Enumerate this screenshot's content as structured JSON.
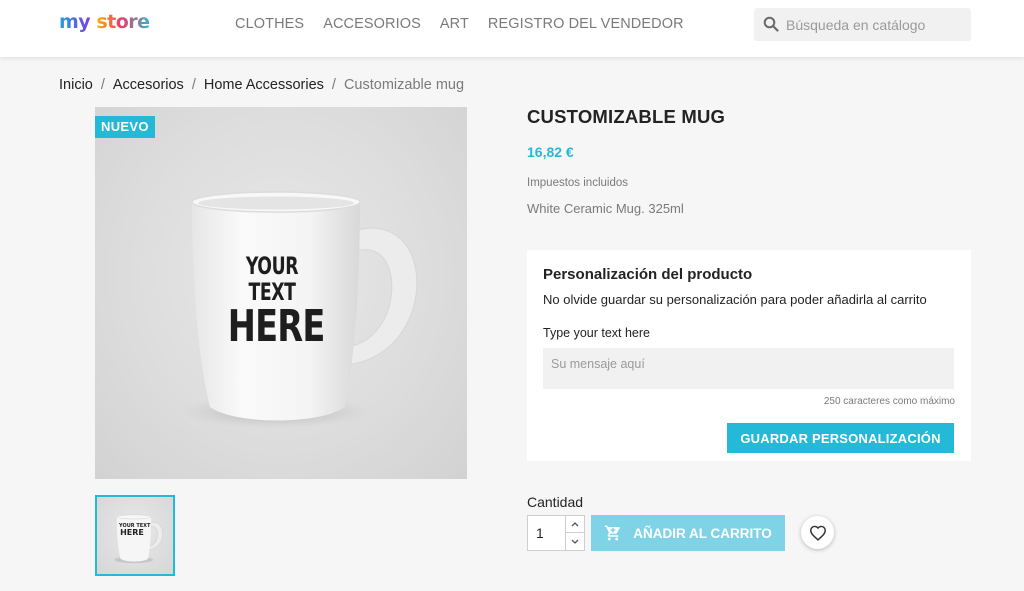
{
  "header": {
    "logo": {
      "part1": "my",
      "part2": "store"
    },
    "nav": [
      {
        "label": "CLOTHES"
      },
      {
        "label": "ACCESORIOS"
      },
      {
        "label": "ART"
      },
      {
        "label": "REGISTRO DEL VENDEDOR"
      }
    ],
    "search": {
      "placeholder": "Búsqueda en catálogo",
      "icon": "search-icon"
    }
  },
  "breadcrumb": {
    "items": [
      "Inicio",
      "Accesorios",
      "Home Accessories"
    ],
    "current": "Customizable mug",
    "separator": "/"
  },
  "product": {
    "badge": "NUEVO",
    "image_text_line1": "YOUR TEXT",
    "image_text_line2": "HERE",
    "title": "CUSTOMIZABLE MUG",
    "price": "16,82 €",
    "tax_note": "Impuestos incluidos",
    "description": "White Ceramic Mug. 325ml"
  },
  "customization": {
    "heading": "Personalización del producto",
    "note": "No olvide guardar su personalización para poder añadirla al carrito",
    "field_label": "Type your text here",
    "placeholder": "Su mensaje aquí",
    "max_chars": "250 caracteres como máximo",
    "save_label": "GUARDAR PERSONALIZACIÓN"
  },
  "purchase": {
    "quantity_label": "Cantidad",
    "quantity_value": "1",
    "add_to_cart_label": "AÑADIR AL CARRITO",
    "cart_icon": "cart-icon",
    "wishlist_icon": "heart-icon"
  },
  "colors": {
    "accent": "#24b9d7",
    "accent_disabled": "#7fd3e6",
    "background": "#f6f6f6",
    "text": "#232323",
    "muted": "#7a7a7a"
  }
}
